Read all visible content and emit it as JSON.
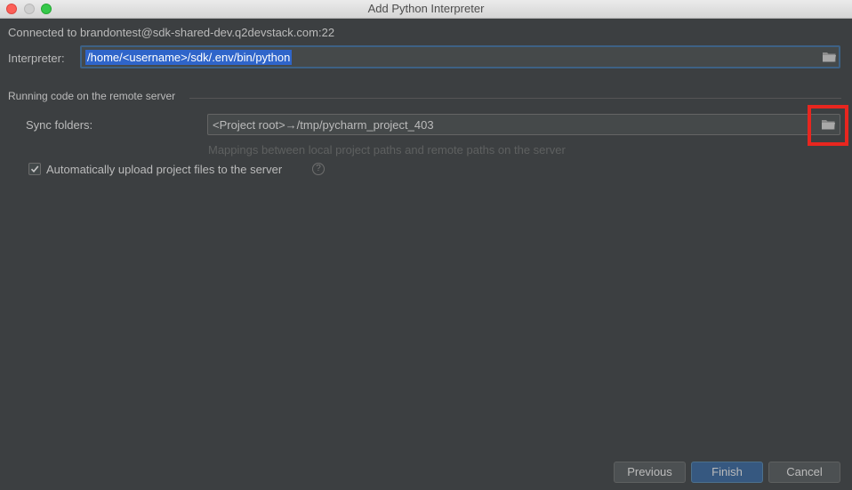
{
  "window": {
    "title": "Add Python Interpreter"
  },
  "connection": {
    "text": "Connected to brandontest@sdk-shared-dev.q2devstack.com:22"
  },
  "interpreter": {
    "label": "Interpreter:",
    "value": "/home/<username>/sdk/.env/bin/python",
    "browse_icon": "folder-icon"
  },
  "section": {
    "title": "Running code on the remote server"
  },
  "sync": {
    "label": "Sync folders:",
    "value": "<Project root>→/tmp/pycharm_project_403",
    "hint": "Mappings between local project paths and remote paths on the server",
    "browse_icon": "folder-icon"
  },
  "auto_upload": {
    "label": "Automatically upload project files to the server",
    "checked": true,
    "help_glyph": "?"
  },
  "buttons": {
    "previous": "Previous",
    "finish": "Finish",
    "cancel": "Cancel"
  },
  "colors": {
    "background": "#3c3f41",
    "highlight_box": "#e8261f",
    "selection": "#2f65ca",
    "default_button": "#365880"
  }
}
